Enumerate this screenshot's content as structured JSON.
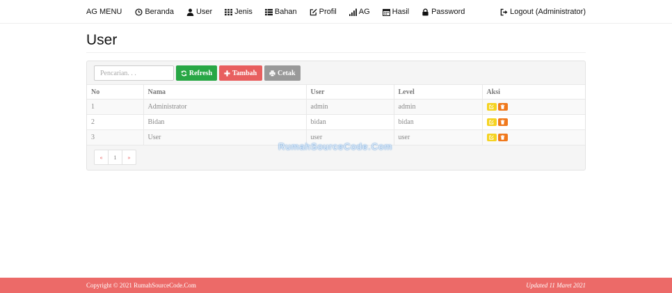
{
  "nav": {
    "brand": "AG MENU",
    "items": [
      {
        "label": "Beranda",
        "icon": "clock-icon"
      },
      {
        "label": "User",
        "icon": "user-icon"
      },
      {
        "label": "Jenis",
        "icon": "grid-icon"
      },
      {
        "label": "Bahan",
        "icon": "list-icon"
      },
      {
        "label": "Profil",
        "icon": "edit-icon"
      },
      {
        "label": "AG",
        "icon": "signal-icon"
      },
      {
        "label": "Hasil",
        "icon": "calendar-icon"
      },
      {
        "label": "Password",
        "icon": "lock-icon"
      }
    ],
    "logout": "Logout (Administrator)"
  },
  "page": {
    "title": "User"
  },
  "toolbar": {
    "search_placeholder": "Pencarian. . .",
    "refresh_label": "Refresh",
    "tambah_label": "Tambah",
    "cetak_label": "Cetak"
  },
  "table": {
    "headers": [
      "No",
      "Nama",
      "User",
      "Level",
      "Aksi"
    ],
    "rows": [
      [
        "1",
        "Administrator",
        "admin",
        "admin"
      ],
      [
        "2",
        "Bidan",
        "bidan",
        "bidan"
      ],
      [
        "3",
        "User",
        "user",
        "user"
      ]
    ]
  },
  "pagination": {
    "prev": "«",
    "page": "1",
    "next": "»"
  },
  "watermark": "RumahSourceCode.Com",
  "footer": {
    "copyright": "Copyright © 2021 RumahSourceCode.Com",
    "updated": "Updated 11 Maret 2021"
  },
  "colors": {
    "refresh": "#28a745",
    "tambah": "#e85f5f",
    "cetak": "#999999",
    "edit": "#f5d320",
    "delete": "#f0781b",
    "footer": "#ec6a68"
  }
}
